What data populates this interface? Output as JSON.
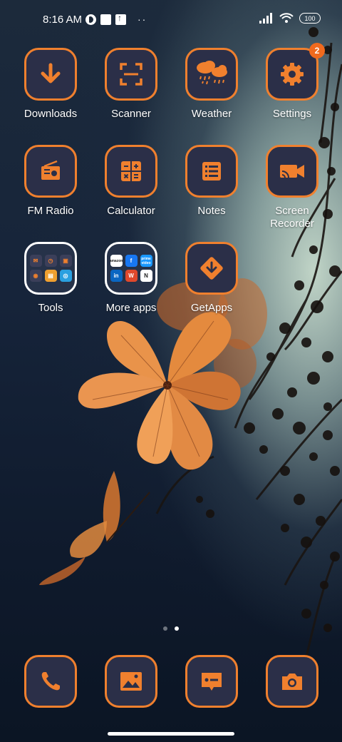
{
  "status_bar": {
    "time": "8:16 AM",
    "battery": "100",
    "overflow": "··"
  },
  "apps": [
    {
      "label": "Downloads",
      "icon": "download-icon"
    },
    {
      "label": "Scanner",
      "icon": "scanner-icon"
    },
    {
      "label": "Weather",
      "icon": "weather-icon"
    },
    {
      "label": "Settings",
      "icon": "gear-icon",
      "badge": "2"
    },
    {
      "label": "FM Radio",
      "icon": "radio-icon"
    },
    {
      "label": "Calculator",
      "icon": "calculator-icon"
    },
    {
      "label": "Notes",
      "icon": "notes-icon"
    },
    {
      "label": "Screen\nRecorder",
      "icon": "video-camera-icon"
    },
    {
      "label": "Tools",
      "icon": "folder-icon"
    },
    {
      "label": "More apps",
      "icon": "folder-icon"
    },
    {
      "label": "GetApps",
      "icon": "getapps-icon"
    }
  ],
  "folders": {
    "more_apps_minis": [
      "amazon",
      "f",
      "prime video",
      "in",
      "W",
      "N"
    ]
  },
  "dock": [
    {
      "icon": "phone-icon"
    },
    {
      "icon": "gallery-icon"
    },
    {
      "icon": "messages-icon"
    },
    {
      "icon": "camera-icon"
    }
  ],
  "colors": {
    "accent": "#f0802e",
    "icon_bg": "#2b2f48",
    "badge": "#f06a1e"
  }
}
